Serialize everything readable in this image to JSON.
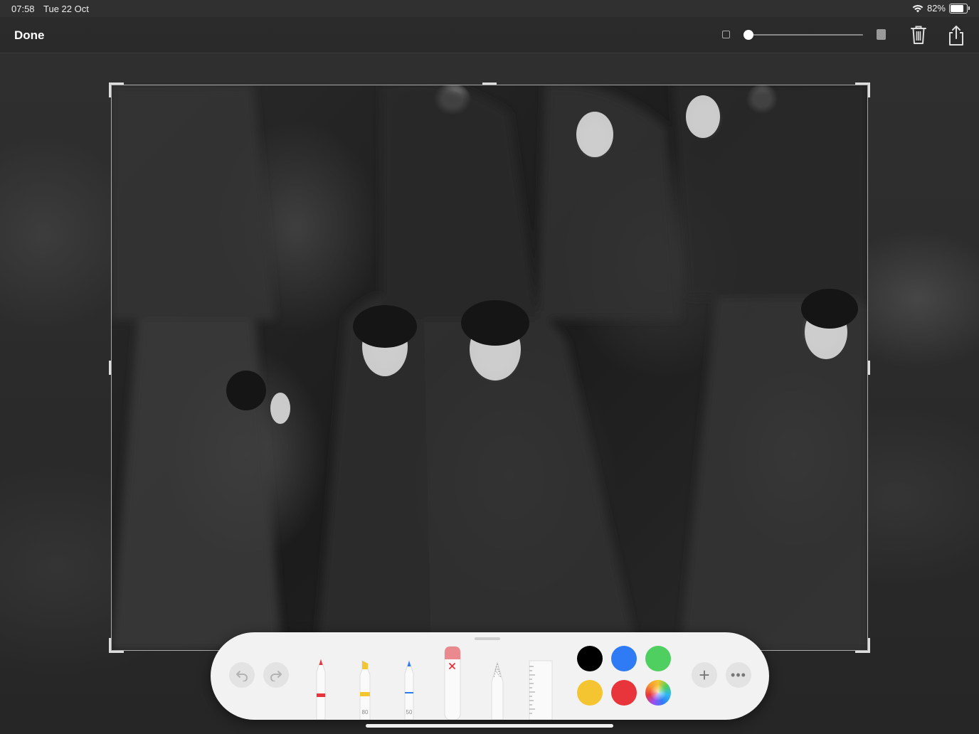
{
  "status_bar": {
    "time": "07:58",
    "date": "Tue 22 Oct",
    "battery": "82%",
    "battery_level": 0.82
  },
  "toolbar": {
    "done_label": "Done",
    "stroke_size_level": 0.0,
    "icons": {
      "small_size": "small-square-icon",
      "large_size": "large-square-icon",
      "trash": "trash-icon",
      "share": "share-icon"
    }
  },
  "photo": {
    "icon": "photo-icon"
  },
  "palette": {
    "tools": [
      {
        "name": "pen",
        "color": "#e8343b",
        "label": ""
      },
      {
        "name": "marker",
        "color": "#f2c630",
        "label": "80"
      },
      {
        "name": "pencil",
        "color": "#2f7bf6",
        "label": "50"
      },
      {
        "name": "eraser",
        "color": "#ea8a8e",
        "label": ""
      },
      {
        "name": "lasso",
        "color": "#cccccc",
        "label": ""
      },
      {
        "name": "ruler",
        "color": "#ffffff",
        "label": ""
      }
    ],
    "colors": [
      "#000000",
      "#2f7bf6",
      "#4fcf5f",
      "#f5c531",
      "#e8343b",
      "rainbow"
    ],
    "add_label": "+",
    "more_label": "•••"
  }
}
